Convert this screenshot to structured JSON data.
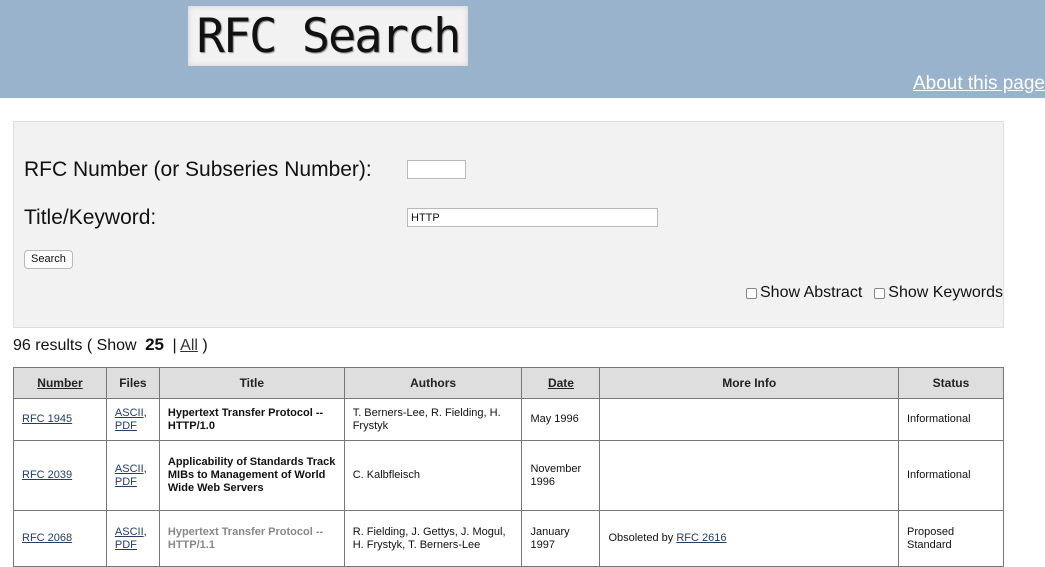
{
  "header": {
    "logo_text": "RFC Search",
    "about_link": "About this page"
  },
  "form": {
    "number_label": "RFC Number (or Subseries Number):",
    "number_value": "",
    "title_label": "Title/Keyword:",
    "title_value": "HTTP",
    "search_button": "Search",
    "show_abstract": "Show Abstract",
    "show_keywords": "Show Keywords"
  },
  "results": {
    "count_text": "96 results ( Show",
    "page_size": "25",
    "separator": "|",
    "all_link": "All",
    "close_paren": ")"
  },
  "table": {
    "headers": {
      "number": "Number",
      "files": "Files",
      "title": "Title",
      "authors": "Authors",
      "date": "Date",
      "more_info": "More Info",
      "status": "Status"
    },
    "rows": [
      {
        "number": "RFC 1945",
        "file_ascii": "ASCII",
        "file_sep": ",",
        "file_pdf": "PDF",
        "title": "Hypertext Transfer Protocol -- HTTP/1.0",
        "authors": "T. Berners-Lee, R. Fielding, H. Frystyk",
        "date": "May 1996",
        "more_info_text": "",
        "more_info_link": "",
        "status": "Informational"
      },
      {
        "number": "RFC 2039",
        "file_ascii": "ASCII",
        "file_sep": ",",
        "file_pdf": "PDF",
        "title": "Applicability of Standards Track MIBs to Management of World Wide Web Servers",
        "authors": "C. Kalbfleisch",
        "date": "November 1996",
        "more_info_text": "",
        "more_info_link": "",
        "status": "Informational"
      },
      {
        "number": "RFC 2068",
        "file_ascii": "ASCII",
        "file_sep": ",",
        "file_pdf": "PDF",
        "title": "Hypertext Transfer Protocol -- HTTP/1.1",
        "authors": "R. Fielding, J. Gettys, J. Mogul, H. Frystyk, T. Berners-Lee",
        "date": "January 1997",
        "more_info_text": "Obsoleted by",
        "more_info_link": "RFC 2616",
        "status": "Proposed Standard"
      }
    ]
  },
  "colors": {
    "header_bg": "#99b3cc",
    "form_bg": "#f2f2f2",
    "table_header_bg": "#dedede",
    "link": "#223c6b"
  }
}
